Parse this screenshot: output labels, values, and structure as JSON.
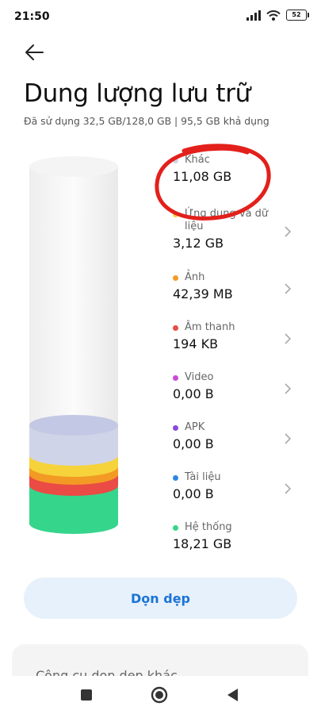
{
  "status": {
    "time": "21:50",
    "battery": "52"
  },
  "header": {
    "title": "Dung lượng lưu trữ",
    "subtitle": "Đã sử dụng 32,5 GB/128,0 GB | 95,5 GB khả dụng"
  },
  "categories": [
    {
      "name": "Khác",
      "size": "11,08 GB",
      "color": "#d0d4e2",
      "chevron": false
    },
    {
      "name": "Ứng dụng và dữ liệu",
      "size": "3,12 GB",
      "color": "#f6d33a",
      "chevron": true
    },
    {
      "name": "Ảnh",
      "size": "42,39 MB",
      "color": "#f39a25",
      "chevron": true
    },
    {
      "name": "Âm thanh",
      "size": "194 KB",
      "color": "#ea4b45",
      "chevron": true
    },
    {
      "name": "Video",
      "size": "0,00 B",
      "color": "#c94bd6",
      "chevron": true
    },
    {
      "name": "APK",
      "size": "0,00 B",
      "color": "#8a4bd9",
      "chevron": true
    },
    {
      "name": "Tài liệu",
      "size": "0,00 B",
      "color": "#2f86e0",
      "chevron": true
    },
    {
      "name": "Hệ thống",
      "size": "18,21 GB",
      "color": "#36d58c",
      "chevron": false
    }
  ],
  "actions": {
    "clean_label": "Dọn dẹp"
  },
  "bottom_card": {
    "label": "Công cụ dọn dẹp khác"
  },
  "colors": {
    "accent": "#1a74d6",
    "annotation": "#e3201b"
  }
}
